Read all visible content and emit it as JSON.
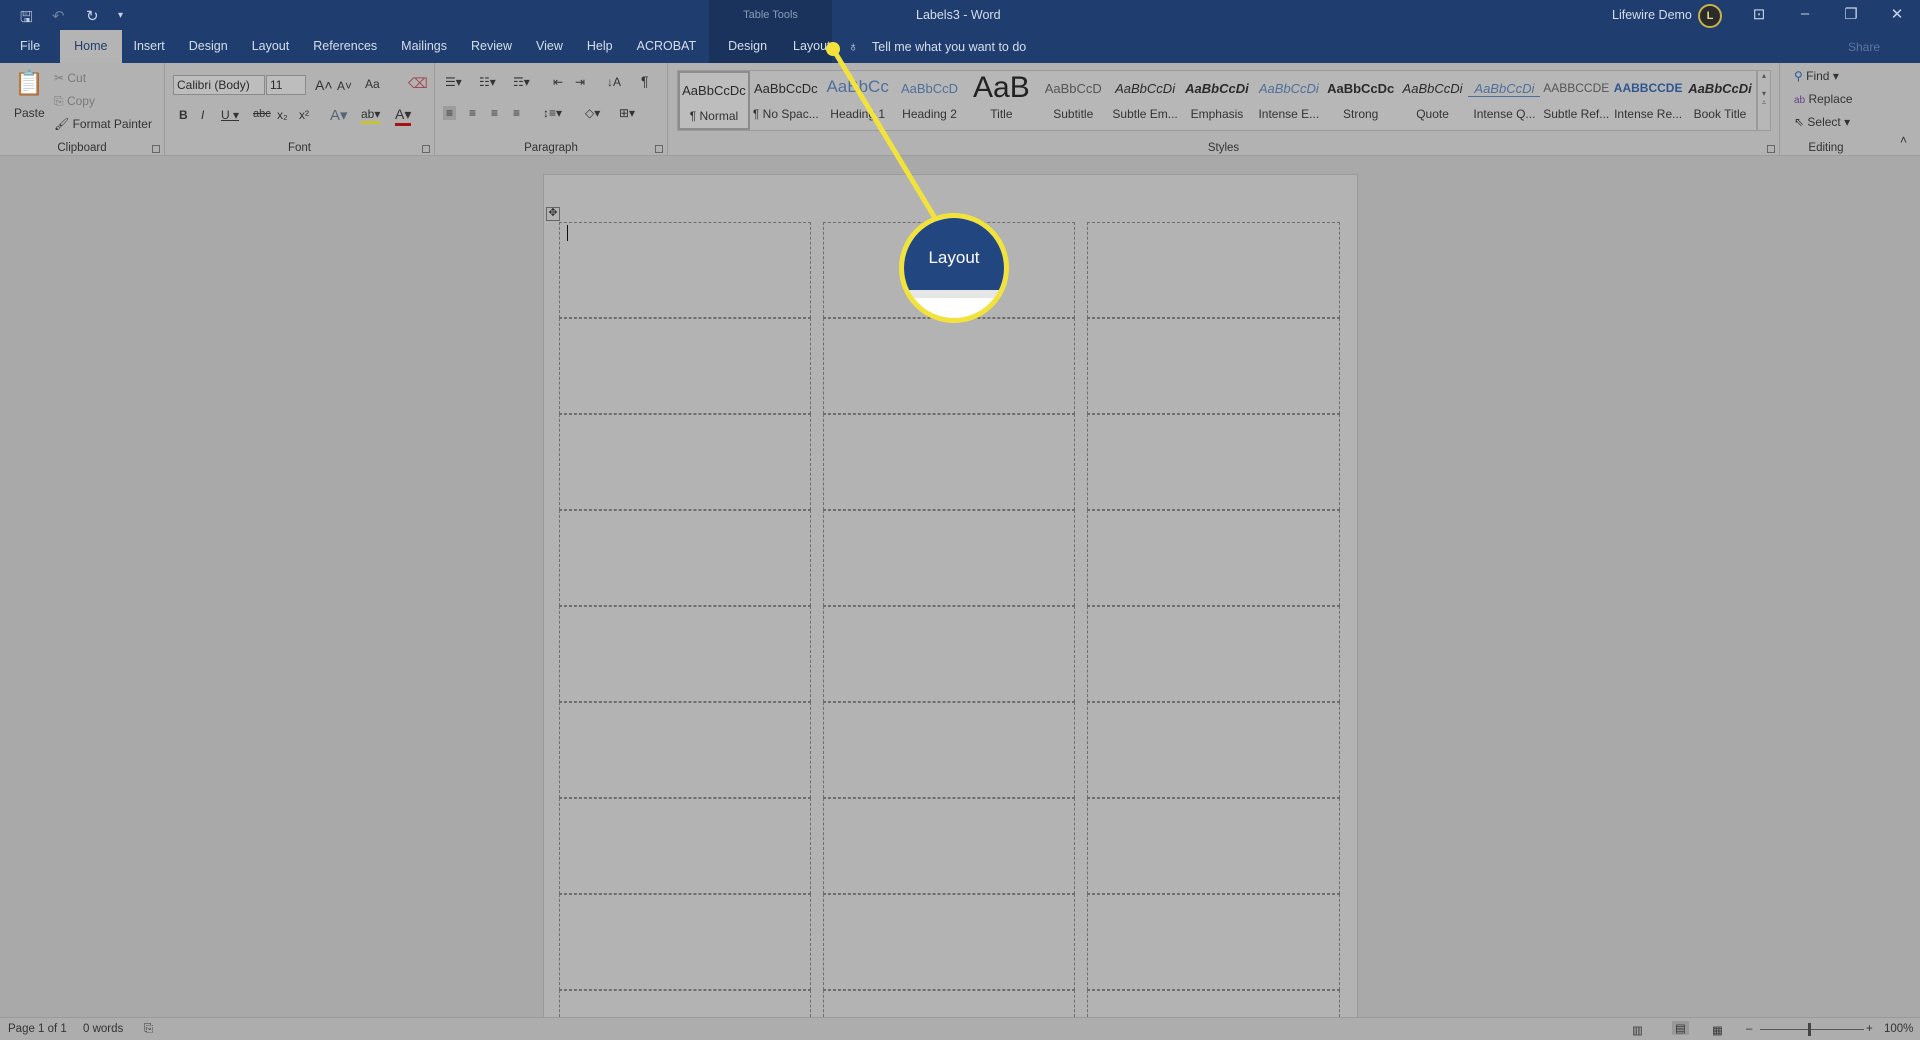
{
  "titlebar": {
    "document_title": "Labels3  -  Word",
    "contextual_group": "Table Tools",
    "user_name": "Lifewire Demo",
    "avatar_text": "Lif",
    "colors": {
      "titlebar": "#1f3e6f",
      "highlight": "#f2e33c"
    }
  },
  "quick_access": [
    {
      "icon": "save-icon"
    },
    {
      "icon": "undo-icon"
    },
    {
      "icon": "redo-icon"
    },
    {
      "icon": "customize-icon"
    }
  ],
  "tabs": [
    {
      "label": "File"
    },
    {
      "label": "Home",
      "active": true
    },
    {
      "label": "Insert"
    },
    {
      "label": "Design"
    },
    {
      "label": "Layout"
    },
    {
      "label": "References"
    },
    {
      "label": "Mailings"
    },
    {
      "label": "Review"
    },
    {
      "label": "View"
    },
    {
      "label": "Help"
    },
    {
      "label": "ACROBAT"
    },
    {
      "label": "Design"
    },
    {
      "label": "Layout"
    }
  ],
  "tell_me": "Tell me what you want to do",
  "share": "Share",
  "ribbon": {
    "clipboard": {
      "label": "Clipboard",
      "paste": "Paste",
      "cut": "Cut",
      "copy": "Copy",
      "format_painter": "Format Painter"
    },
    "font": {
      "label": "Font",
      "font_name": "Calibri (Body)",
      "font_size": "11",
      "case": "Aa"
    },
    "paragraph": {
      "label": "Paragraph"
    },
    "styles": {
      "label": "Styles",
      "items": [
        {
          "preview": "AaBbCcDc",
          "name": "¶ Normal"
        },
        {
          "preview": "AaBbCcDc",
          "name": "¶ No Spac..."
        },
        {
          "preview": "AaBbCc",
          "name": "Heading 1"
        },
        {
          "preview": "AaBbCcD",
          "name": "Heading 2"
        },
        {
          "preview": "AaB",
          "name": "Title"
        },
        {
          "preview": "AaBbCcD",
          "name": "Subtitle"
        },
        {
          "preview": "AaBbCcDi",
          "name": "Subtle Em..."
        },
        {
          "preview": "AaBbCcDi",
          "name": "Emphasis"
        },
        {
          "preview": "AaBbCcDi",
          "name": "Intense E..."
        },
        {
          "preview": "AaBbCcDc",
          "name": "Strong"
        },
        {
          "preview": "AaBbCcDi",
          "name": "Quote"
        },
        {
          "preview": "AaBbCcDi",
          "name": "Intense Q..."
        },
        {
          "preview": "AABBCCDE",
          "name": "Subtle Ref..."
        },
        {
          "preview": "AABBCCDE",
          "name": "Intense Re..."
        },
        {
          "preview": "AaBbCcDi",
          "name": "Book Title"
        }
      ]
    },
    "editing": {
      "label": "Editing",
      "find": "Find",
      "replace": "Replace",
      "select": "Select"
    }
  },
  "callout": {
    "label": "Layout"
  },
  "status": {
    "page": "Page 1 of 1",
    "words": "0 words",
    "zoom": "100%"
  }
}
